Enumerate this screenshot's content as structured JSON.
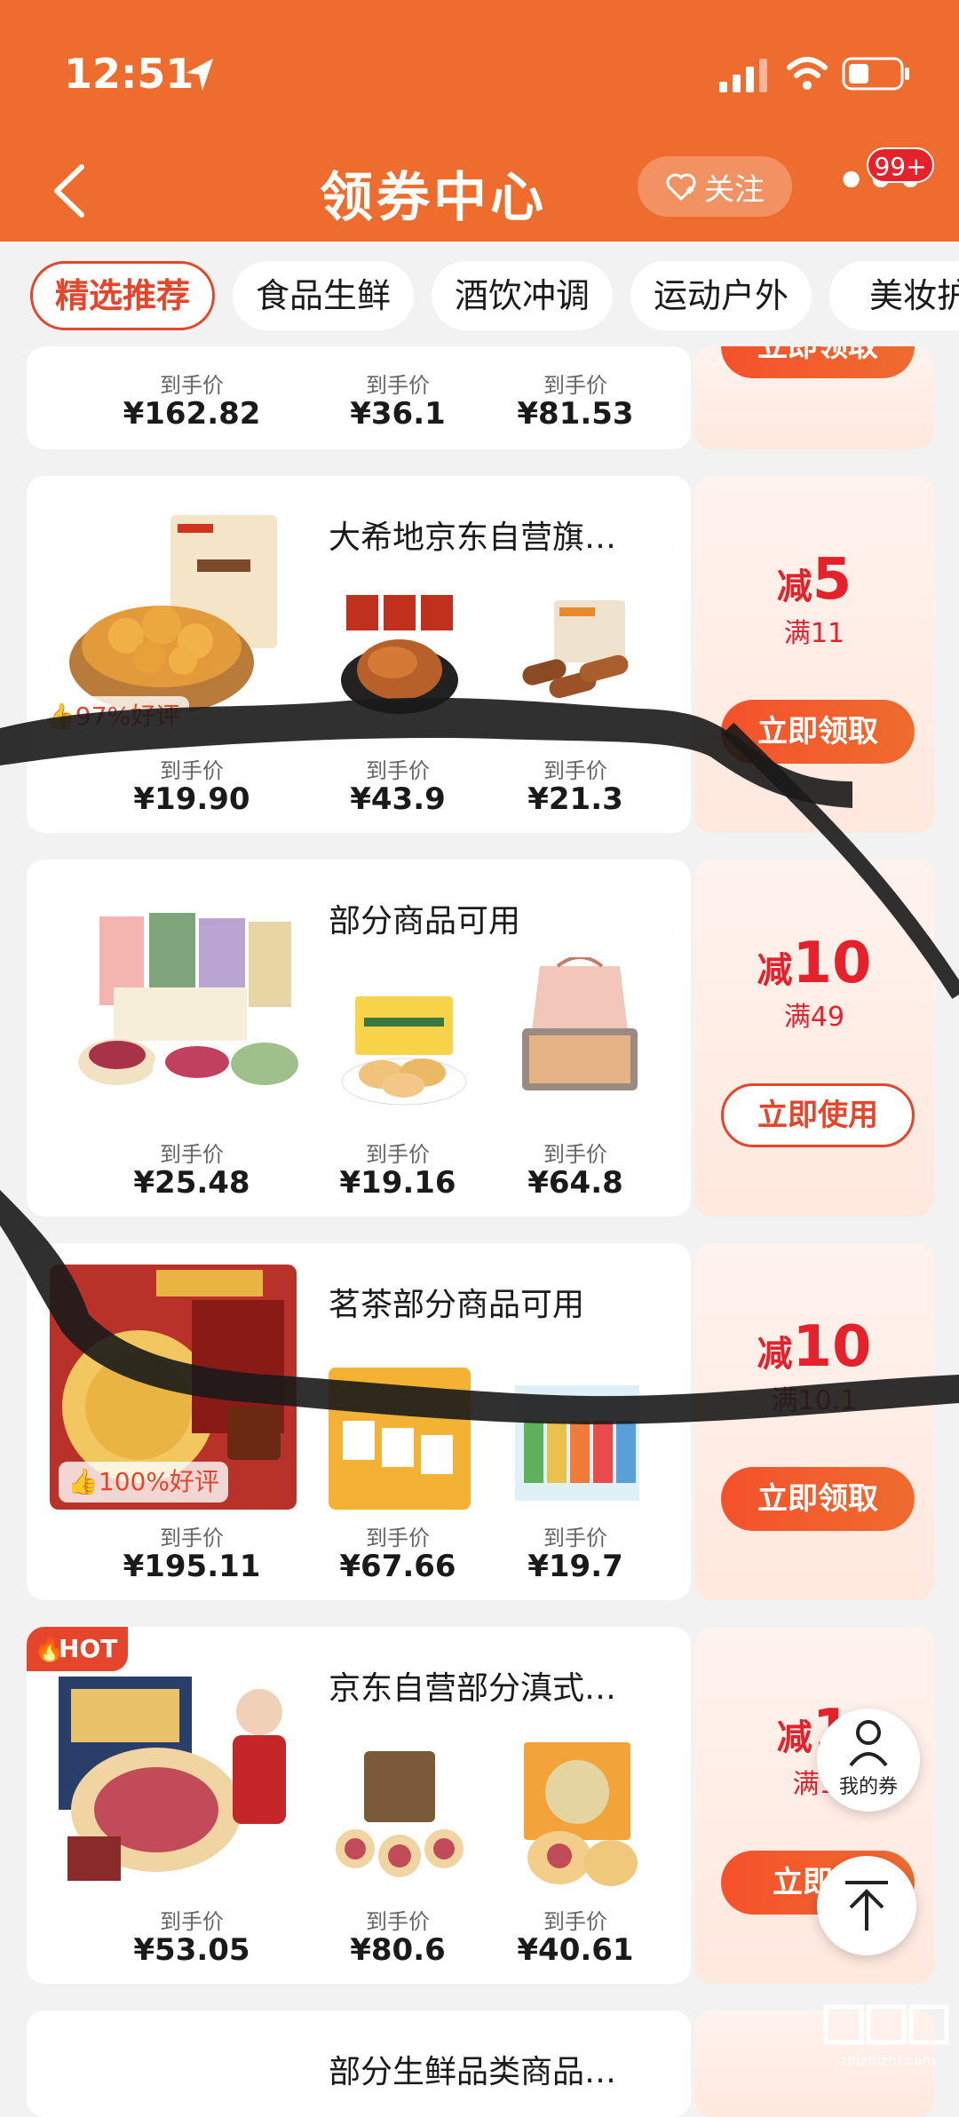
{
  "status": {
    "time": "12:51"
  },
  "nav": {
    "title": "领券中心",
    "follow_label": "关注",
    "badge": "99+"
  },
  "tabs": [
    "精选推荐",
    "食品生鲜",
    "酒饮冲调",
    "运动户外",
    "美妆护"
  ],
  "price_label": "到手价",
  "cards": [
    {
      "shop": "",
      "prices": [
        "¥162.82",
        "¥36.1",
        "¥81.53"
      ],
      "button": "立即领取"
    },
    {
      "shop": "大希地京东自营旗…",
      "rating": "97%好评",
      "prices": [
        "¥19.90",
        "¥43.9",
        "¥21.3"
      ],
      "amount": "5",
      "condition": "满11",
      "button": "立即领取"
    },
    {
      "shop": "部分商品可用",
      "prices": [
        "¥25.48",
        "¥19.16",
        "¥64.8"
      ],
      "amount": "10",
      "condition": "满49",
      "button": "立即使用"
    },
    {
      "shop": "茗茶部分商品可用",
      "rating": "100%好评",
      "prices": [
        "¥195.11",
        "¥67.66",
        "¥19.7"
      ],
      "amount": "10",
      "condition": "满10.1",
      "button": "立即领取"
    },
    {
      "shop": "京东自营部分滇式…",
      "hot": "HOT",
      "prices": [
        "¥53.05",
        "¥80.6",
        "¥40.61"
      ],
      "amount": "1",
      "condition": "满1",
      "button": "立即领"
    },
    {
      "shop": "部分生鲜品类商品…"
    }
  ],
  "coupon_prefix": "减",
  "float": {
    "my_coupons": "我的券"
  },
  "colors": {
    "brand": "#ee6c2e",
    "accent": "#e5222c",
    "background": "#f2f2f2"
  },
  "icons": [
    "back-icon",
    "heart-plus-icon",
    "more-icon",
    "location-arrow-icon",
    "signal-icon",
    "wifi-icon",
    "battery-icon",
    "person-icon",
    "arrow-up-icon",
    "fire-icon",
    "thumb-up-icon"
  ]
}
